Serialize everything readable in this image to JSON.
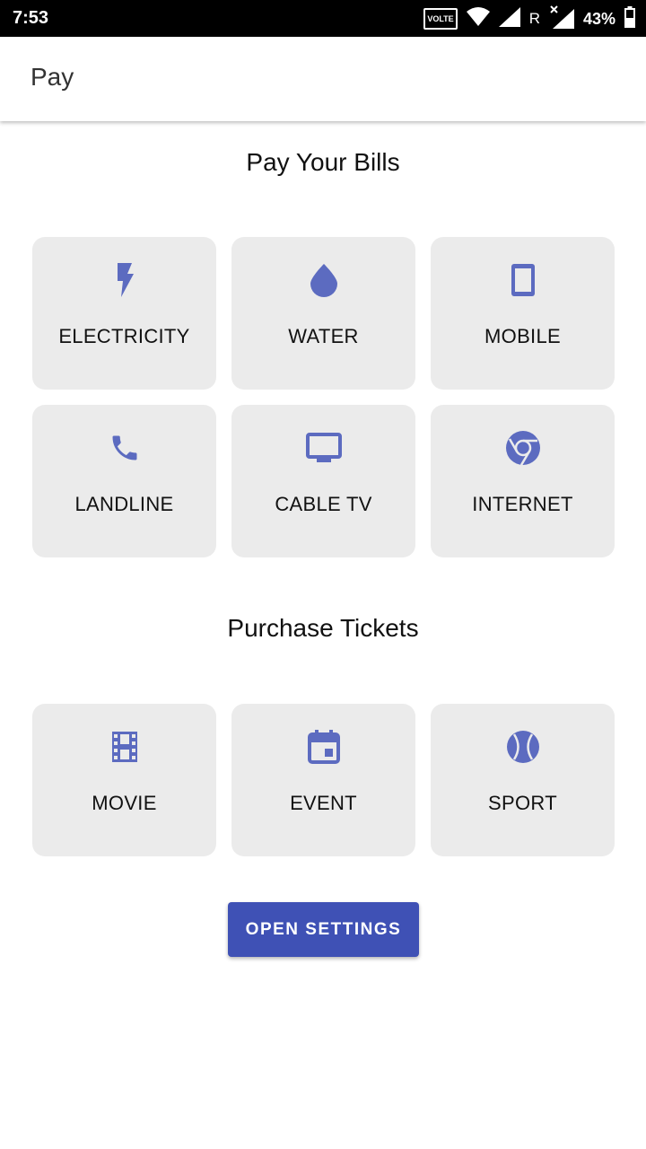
{
  "status_bar": {
    "time": "7:53",
    "volte": "VOLTE",
    "roaming": "R",
    "battery": "43%"
  },
  "app_bar": {
    "title": "Pay"
  },
  "bills": {
    "title": "Pay Your Bills",
    "items": [
      {
        "label": "ELECTRICITY",
        "icon": "flash-icon"
      },
      {
        "label": "WATER",
        "icon": "water-drop-icon"
      },
      {
        "label": "MOBILE",
        "icon": "smartphone-icon"
      },
      {
        "label": "LANDLINE",
        "icon": "phone-icon"
      },
      {
        "label": "CABLE TV",
        "icon": "tv-icon"
      },
      {
        "label": "INTERNET",
        "icon": "chrome-icon"
      }
    ]
  },
  "tickets": {
    "title": "Purchase Tickets",
    "items": [
      {
        "label": "MOVIE",
        "icon": "film-icon"
      },
      {
        "label": "EVENT",
        "icon": "calendar-event-icon"
      },
      {
        "label": "SPORT",
        "icon": "ball-icon"
      }
    ]
  },
  "open_settings_label": "OPEN SETTINGS",
  "colors": {
    "accent": "#3f51b5",
    "icon": "#5c6bc0",
    "tile_bg": "#ebebeb"
  }
}
